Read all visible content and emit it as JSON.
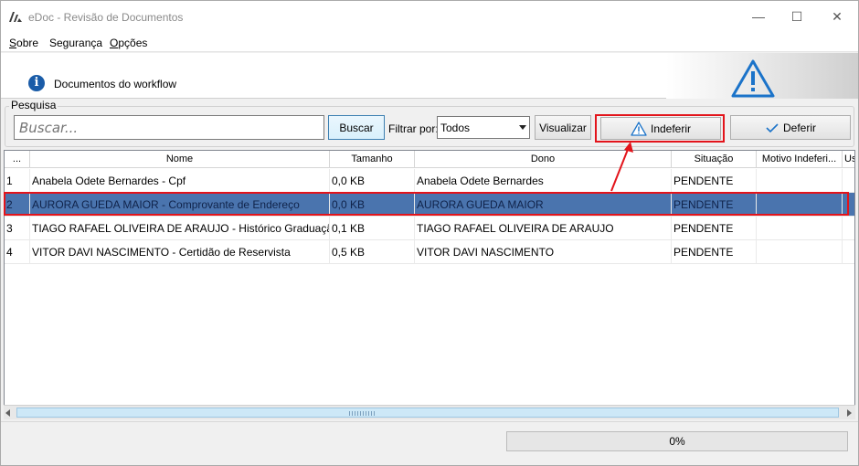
{
  "window": {
    "title": "eDoc - Revisão de Documentos",
    "minimize_glyph": "—",
    "maximize_glyph": "☐",
    "close_glyph": "✕"
  },
  "menu": [
    {
      "underline": "S",
      "rest": "obre"
    },
    {
      "underline": "",
      "rest": "Segurança"
    },
    {
      "underline": "O",
      "rest": "pções"
    }
  ],
  "banner": {
    "title": "Documentos do workflow",
    "info_icon": "info-icon",
    "warning_icon": "warning-icon"
  },
  "search": {
    "group_label": "Pesquisa",
    "placeholder": "Buscar...",
    "value": "",
    "search_button": "Buscar",
    "filter_label": "Filtrar por:",
    "filter_selected": "Todos",
    "view_button": "Visualizar",
    "reject_button": "Indeferir",
    "approve_button": "Deferir"
  },
  "table": {
    "columns": [
      "...",
      "Nome",
      "Tamanho",
      "Dono",
      "Situação",
      "Motivo Indeferi...",
      "Us"
    ],
    "rows": [
      {
        "id": "1",
        "nome": "Anabela Odete Bernardes - Cpf",
        "tamanho": "0,0 KB",
        "dono": "Anabela Odete Bernardes",
        "situacao": "PENDENTE",
        "motivo": "",
        "us": ""
      },
      {
        "id": "2",
        "nome": "AURORA GUEDA MAIOR - Comprovante de Endereço",
        "tamanho": "0,0 KB",
        "dono": "AURORA GUEDA MAIOR",
        "situacao": "PENDENTE",
        "motivo": "",
        "us": ""
      },
      {
        "id": "3",
        "nome": "TIAGO RAFAEL OLIVEIRA DE ARAUJO - Histórico Graduação",
        "tamanho": "0,1 KB",
        "dono": "TIAGO RAFAEL OLIVEIRA DE ARAUJO",
        "situacao": "PENDENTE",
        "motivo": "",
        "us": ""
      },
      {
        "id": "4",
        "nome": "VITOR DAVI NASCIMENTO - Certidão de Reservista",
        "tamanho": "0,5 KB",
        "dono": "VITOR DAVI NASCIMENTO",
        "situacao": "PENDENTE",
        "motivo": "",
        "us": ""
      }
    ],
    "selected_row": 1
  },
  "progress": {
    "label": "0%",
    "value": 0
  },
  "colors": {
    "selection": "#4a74ae",
    "highlight": "#e3141b",
    "info": "#1a5ca8",
    "warning": "#1b73c9"
  }
}
